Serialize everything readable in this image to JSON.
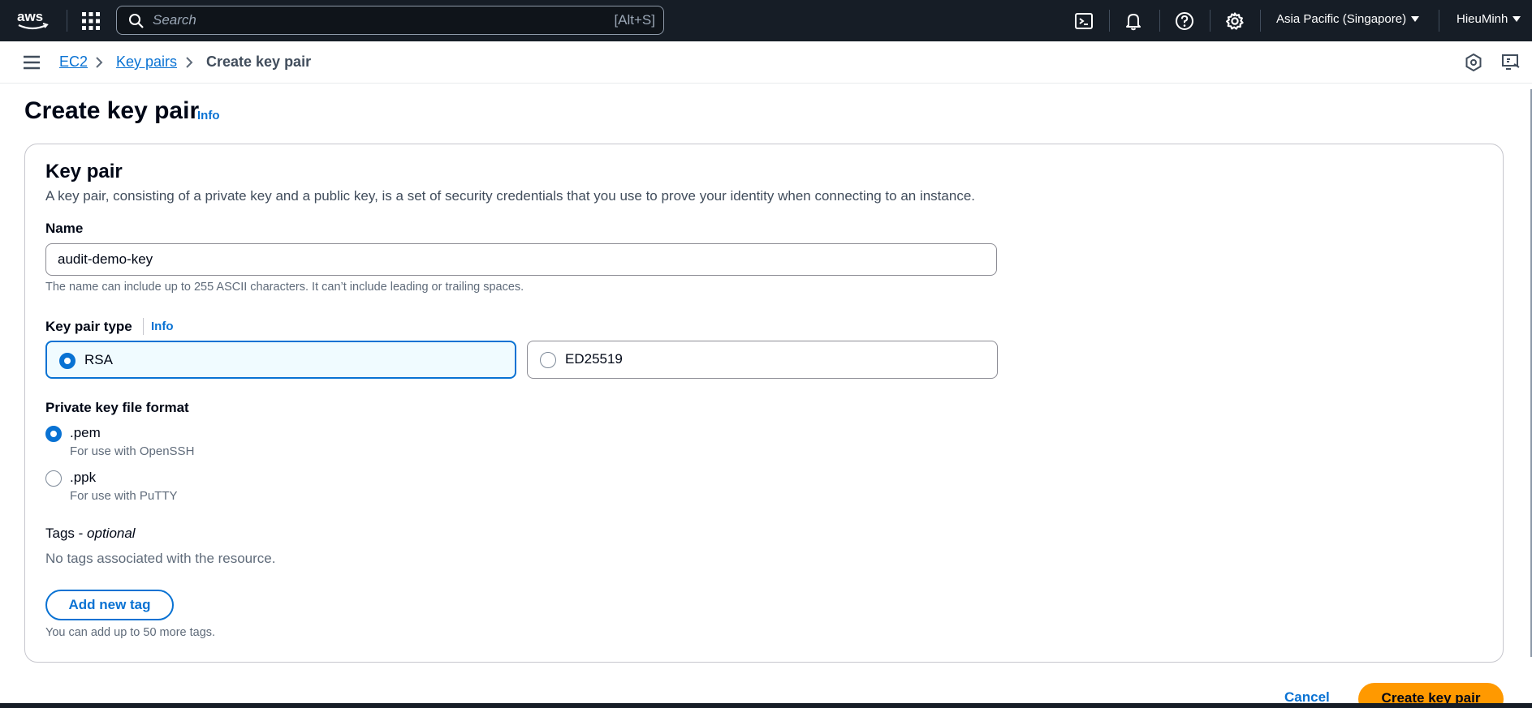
{
  "topnav": {
    "search_placeholder": "Search",
    "search_shortcut": "[Alt+S]",
    "region": "Asia Pacific (Singapore)",
    "user": "HieuMinh"
  },
  "breadcrumb": {
    "items": [
      "EC2",
      "Key pairs"
    ],
    "current": "Create key pair"
  },
  "page": {
    "title": "Create key pair",
    "info": "Info"
  },
  "keypair": {
    "title": "Key pair",
    "description": "A key pair, consisting of a private key and a public key, is a set of security credentials that you use to prove your identity when connecting to an instance.",
    "name_label": "Name",
    "name_value": "audit-demo-key",
    "name_hint": "The name can include up to 255 ASCII characters. It can’t include leading or trailing spaces.",
    "type_label": "Key pair type",
    "type_info": "Info",
    "types": [
      "RSA",
      "ED25519"
    ],
    "selected_type": "RSA",
    "format_label": "Private key file format",
    "formats": [
      {
        "label": ".pem",
        "desc": "For use with OpenSSH",
        "selected": true
      },
      {
        "label": ".ppk",
        "desc": "For use with PuTTY",
        "selected": false
      }
    ],
    "tags_label": "Tags - ",
    "tags_optional": "optional",
    "tags_empty": "No tags associated with the resource.",
    "add_tag": "Add new tag",
    "tags_hint": "You can add up to 50 more tags."
  },
  "footer": {
    "cancel": "Cancel",
    "create": "Create key pair"
  },
  "colors": {
    "nav_bg": "#161d26",
    "link": "#0972d3",
    "primary": "#ff9900"
  }
}
